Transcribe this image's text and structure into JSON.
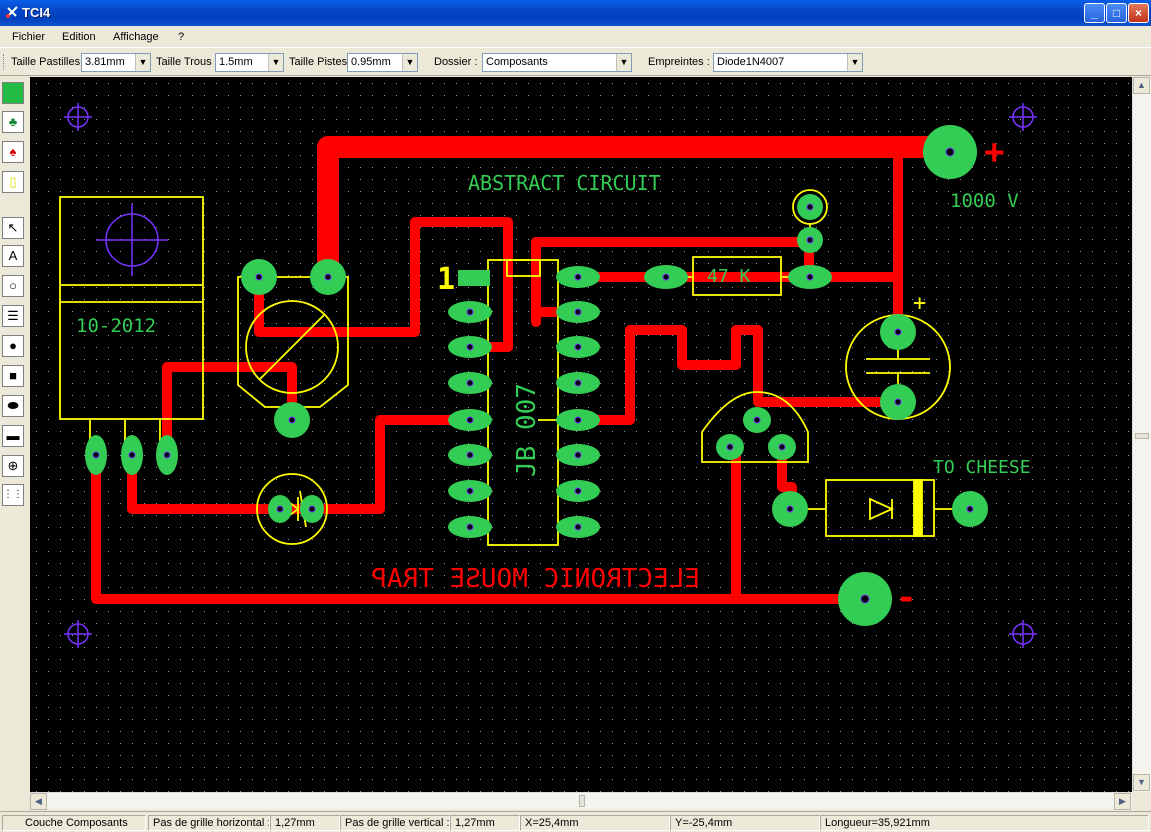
{
  "window": {
    "title": "TCI4",
    "minimize": "_",
    "maximize": "□",
    "close": "×"
  },
  "menu": [
    "Fichier",
    "Edition",
    "Affichage",
    "?"
  ],
  "toolbar": {
    "pad_size_label": "Taille Pastilles",
    "pad_size_value": "3.81mm",
    "hole_size_label": "Taille Trous",
    "hole_size_value": "1.5mm",
    "track_size_label": "Taille Pistes",
    "track_size_value": "0.95mm",
    "folder_label": "Dossier :",
    "folder_value": "Composants",
    "footprint_label": "Empreintes :",
    "footprint_value": "Diode1N4007"
  },
  "tools": [
    {
      "name": "layer-color-icon",
      "glyph": ""
    },
    {
      "name": "green-pin-icon",
      "glyph": "♣"
    },
    {
      "name": "red-pin-icon",
      "glyph": "♠"
    },
    {
      "name": "yellow-frame-icon",
      "glyph": "▯"
    },
    {
      "name": "select-arrow-icon",
      "glyph": "↖"
    },
    {
      "name": "text-tool-icon",
      "glyph": "A"
    },
    {
      "name": "circle-tool-icon",
      "glyph": "○"
    },
    {
      "name": "lines-tool-icon",
      "glyph": "☰"
    },
    {
      "name": "round-pad-icon",
      "glyph": "●"
    },
    {
      "name": "square-pad-icon",
      "glyph": "■"
    },
    {
      "name": "oval-pad-icon",
      "glyph": "⬬"
    },
    {
      "name": "rect-pad-icon",
      "glyph": "▬"
    },
    {
      "name": "crosshair-icon",
      "glyph": "⊕"
    },
    {
      "name": "dil-pads-icon",
      "glyph": "⋮⋮"
    }
  ],
  "pcb": {
    "title_text": "ABSTRACT CIRCUIT",
    "mirrored_text": "ELECTRONIC MOUSE TRAP",
    "voltage_text": "1000 V",
    "plus_sign": "+",
    "minus_sign": "-",
    "cheese_text": "TO CHEESE",
    "resistor_text": "47 K",
    "regulator_text": "10-2012",
    "ic_text": "JB 007",
    "pin1_text": "1",
    "cap_plus": "+"
  },
  "colors": {
    "track": "#ff0000",
    "pad": "#33cc55",
    "silk": "#ffff00",
    "target": "#7733ff",
    "text_green": "#33cc55",
    "background": "#000000"
  },
  "status": {
    "layer": "Couche Composants",
    "hgrid_label": "Pas de grille horizontal :",
    "hgrid_value": "1,27mm",
    "vgrid_label": "Pas de grille vertical :",
    "vgrid_value": "1,27mm",
    "x": "X=25,4mm",
    "y": "Y=-25,4mm",
    "length": "Longueur=35,921mm"
  }
}
